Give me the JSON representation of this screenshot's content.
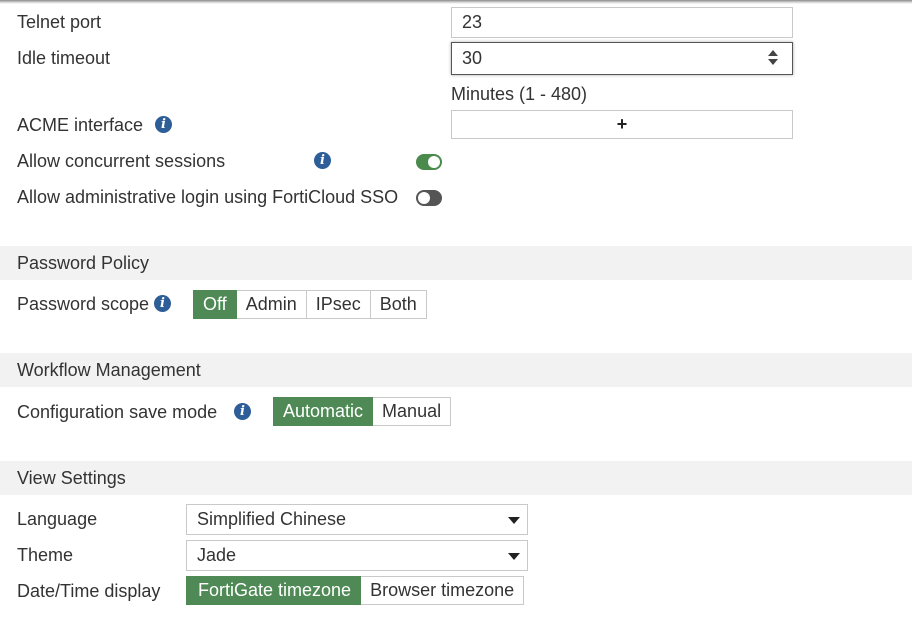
{
  "admin_settings": {
    "telnet_port": {
      "label": "Telnet port",
      "value": "23"
    },
    "idle_timeout": {
      "label": "Idle timeout",
      "value": "30",
      "hint": "Minutes (1 - 480)"
    },
    "acme_interface": {
      "label": "ACME interface",
      "add_symbol": "+"
    },
    "concurrent_sessions": {
      "label": "Allow concurrent sessions",
      "enabled": true
    },
    "forticloud_sso": {
      "label": "Allow administrative login using FortiCloud SSO",
      "enabled": false
    }
  },
  "password_policy": {
    "title": "Password Policy",
    "scope": {
      "label": "Password scope",
      "options": [
        "Off",
        "Admin",
        "IPsec",
        "Both"
      ],
      "selected": "Off"
    }
  },
  "workflow_management": {
    "title": "Workflow Management",
    "save_mode": {
      "label": "Configuration save mode",
      "options": [
        "Automatic",
        "Manual"
      ],
      "selected": "Automatic"
    }
  },
  "view_settings": {
    "title": "View Settings",
    "language": {
      "label": "Language",
      "value": "Simplified Chinese"
    },
    "theme": {
      "label": "Theme",
      "value": "Jade"
    },
    "datetime_display": {
      "label": "Date/Time display",
      "options": [
        "FortiGate timezone",
        "Browser timezone"
      ],
      "selected": "FortiGate timezone"
    }
  },
  "colors": {
    "accent_green": "#4f8a56",
    "info_blue": "#2e5e97",
    "section_bg": "#f2f2f2"
  },
  "icons": [
    "info-icon",
    "toggle-switch",
    "spinner-arrows",
    "plus-icon",
    "dropdown-caret-icon"
  ]
}
